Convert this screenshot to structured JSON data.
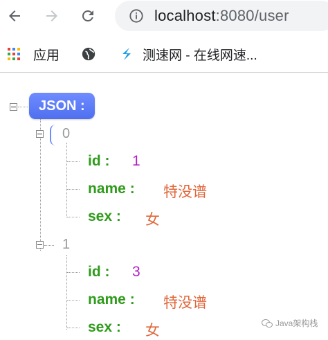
{
  "browser": {
    "url_host": "localhost",
    "url_rest": ":8080/user"
  },
  "bookmarks": [
    {
      "label": "应用",
      "icon": "apps-grid-icon"
    },
    {
      "label": "",
      "icon": "globe-icon"
    },
    {
      "label": "测速网 - 在线网速...",
      "icon": "speedtest-s-icon"
    }
  ],
  "json_root_label": "JSON :",
  "items": [
    {
      "index": "0",
      "fields": [
        {
          "key": "id :",
          "value": "1",
          "type": "number"
        },
        {
          "key": "name :",
          "value": "特没谱",
          "type": "string"
        },
        {
          "key": "sex :",
          "value": "女",
          "type": "string"
        }
      ]
    },
    {
      "index": "1",
      "fields": [
        {
          "key": "id :",
          "value": "3",
          "type": "number"
        },
        {
          "key": "name :",
          "value": "特没谱",
          "type": "string"
        },
        {
          "key": "sex :",
          "value": "女",
          "type": "string"
        }
      ]
    }
  ],
  "watermark": "Java架构栈",
  "colors": {
    "key": "#2e9b1a",
    "number": "#b31cc7",
    "string": "#e0673b",
    "badge": "#5c7cfa"
  }
}
